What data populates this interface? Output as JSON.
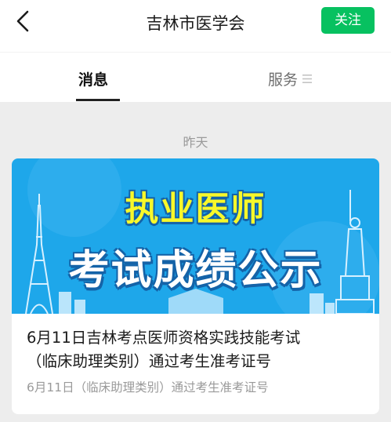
{
  "header": {
    "title": "吉林市医学会",
    "follow_label": "关注"
  },
  "tabs": [
    {
      "label": "消息",
      "active": true
    },
    {
      "label": "服务",
      "icon": "menu-icon"
    }
  ],
  "date_divider": "昨天",
  "article": {
    "banner": {
      "line1": "执业医师",
      "line2": "考试成绩公示"
    },
    "title_lines": [
      "6月11日吉林考点医师资格实践技能考试",
      "（临床助理类别）通过考生准考证号"
    ],
    "digest": "6月11日（临床助理类别）通过考生准考证号"
  },
  "colors": {
    "accent": "#07c160",
    "banner_bg": "#1ea7ea",
    "banner_headline": "#f8f82a"
  }
}
